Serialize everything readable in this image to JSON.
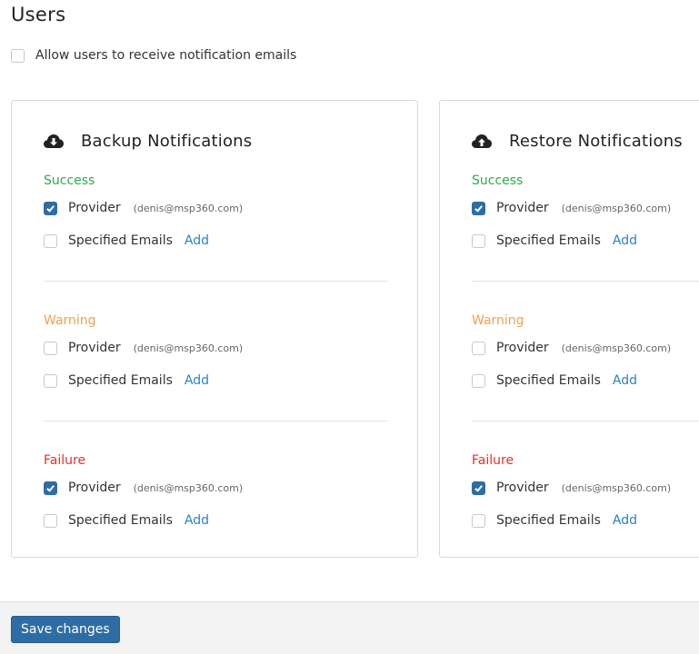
{
  "page": {
    "title": "Users"
  },
  "allow_users": {
    "label": "Allow users to receive notification emails",
    "checked": false
  },
  "cards": [
    {
      "id": "backup",
      "title": "Backup Notifications",
      "icon": "cloud-download-icon",
      "sections": [
        {
          "label": "Success",
          "provider": {
            "label": "Provider",
            "email": "(denis@msp360.com)",
            "checked": true
          },
          "specified": {
            "label": "Specified Emails",
            "checked": false,
            "add_label": "Add"
          }
        },
        {
          "label": "Warning",
          "provider": {
            "label": "Provider",
            "email": "(denis@msp360.com)",
            "checked": false
          },
          "specified": {
            "label": "Specified Emails",
            "checked": false,
            "add_label": "Add"
          }
        },
        {
          "label": "Failure",
          "provider": {
            "label": "Provider",
            "email": "(denis@msp360.com)",
            "checked": true
          },
          "specified": {
            "label": "Specified Emails",
            "checked": false,
            "add_label": "Add"
          }
        }
      ]
    },
    {
      "id": "restore",
      "title": "Restore Notifications",
      "icon": "cloud-upload-icon",
      "sections": [
        {
          "label": "Success",
          "provider": {
            "label": "Provider",
            "email": "(denis@msp360.com)",
            "checked": true
          },
          "specified": {
            "label": "Specified Emails",
            "checked": false,
            "add_label": "Add"
          }
        },
        {
          "label": "Warning",
          "provider": {
            "label": "Provider",
            "email": "(denis@msp360.com)",
            "checked": false
          },
          "specified": {
            "label": "Specified Emails",
            "checked": false,
            "add_label": "Add"
          }
        },
        {
          "label": "Failure",
          "provider": {
            "label": "Provider",
            "email": "(denis@msp360.com)",
            "checked": true
          },
          "specified": {
            "label": "Specified Emails",
            "checked": false,
            "add_label": "Add"
          }
        }
      ]
    }
  ],
  "colors": {
    "success": "#2eaa4b",
    "warning": "#f5a04f",
    "failure": "#e2312d",
    "accent": "#2e6da4",
    "link": "#2a83c4"
  },
  "footer": {
    "save_label": "Save changes"
  }
}
